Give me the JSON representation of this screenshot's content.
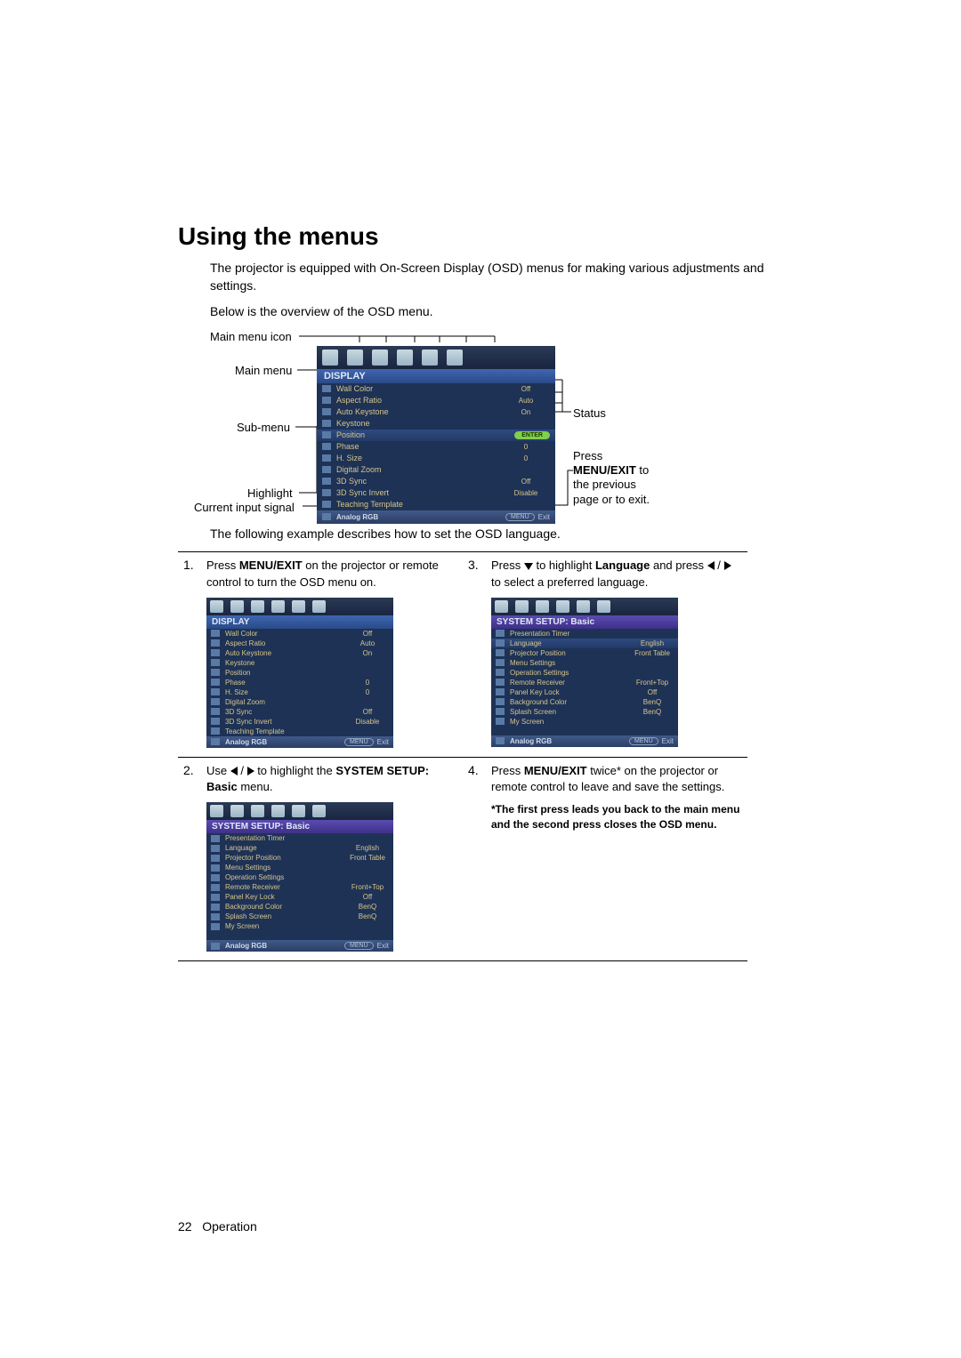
{
  "heading": "Using the menus",
  "intro1": "The projector is equipped with On-Screen Display (OSD) menus for making various adjustments and settings.",
  "intro2": "Below is the overview of the OSD menu.",
  "labels": {
    "main_menu_icon": "Main menu icon",
    "main_menu": "Main menu",
    "sub_menu": "Sub-menu",
    "highlight": "Highlight",
    "current_input": "Current input signal",
    "status": "Status",
    "press_menu_exit": "Press MENU/EXIT to the previous page or to exit."
  },
  "osd_main": {
    "title": "DISPLAY",
    "rows": [
      {
        "label": "Wall Color",
        "value": "Off"
      },
      {
        "label": "Aspect Ratio",
        "value": "Auto"
      },
      {
        "label": "Auto Keystone",
        "value": "On"
      },
      {
        "label": "Keystone",
        "value": ""
      },
      {
        "label": "Position",
        "value": "ENTER",
        "hl": true,
        "enter": true
      },
      {
        "label": "Phase",
        "value": "0"
      },
      {
        "label": "H. Size",
        "value": "0"
      },
      {
        "label": "Digital Zoom",
        "value": ""
      },
      {
        "label": "3D Sync",
        "value": "Off"
      },
      {
        "label": "3D Sync Invert",
        "value": "Disable"
      },
      {
        "label": "Teaching Template",
        "value": ""
      }
    ],
    "footer_signal": "Analog RGB",
    "footer_menu": "MENU",
    "footer_exit": "Exit"
  },
  "example_intro": "The following example describes how to set the OSD language.",
  "steps": {
    "s1": {
      "num": "1.",
      "text_a": "Press ",
      "menu_exit": "MENU/EXIT",
      "text_b": " on the projector or remote control to turn the OSD menu on."
    },
    "s2": {
      "num": "2.",
      "text_a": "Use ",
      "text_b": " to highlight the ",
      "sys": "SYSTEM SETUP: Basic",
      "text_c": " menu."
    },
    "s3": {
      "num": "3.",
      "text_a": "Press ",
      "text_b": " to highlight ",
      "lang": "Language",
      "text_c": " and press ",
      "text_d": " to select a preferred language."
    },
    "s4": {
      "num": "4.",
      "text_a": "Press ",
      "menu_exit": "MENU/EXIT",
      "text_b": " twice* on the projector or remote control to leave and save the settings.",
      "note": "*The first press leads you back to the main menu and the second press closes the OSD menu."
    }
  },
  "osd_sys": {
    "title": "SYSTEM SETUP: Basic",
    "rows": [
      {
        "label": "Presentation Timer",
        "value": ""
      },
      {
        "label": "Language",
        "value": "English"
      },
      {
        "label": "Projector Position",
        "value": "Front Table"
      },
      {
        "label": "Menu Settings",
        "value": ""
      },
      {
        "label": "Operation Settings",
        "value": ""
      },
      {
        "label": "Remote Receiver",
        "value": "Front+Top"
      },
      {
        "label": "Panel Key Lock",
        "value": "Off"
      },
      {
        "label": "Background Color",
        "value": "BenQ"
      },
      {
        "label": "Splash Screen",
        "value": "BenQ"
      },
      {
        "label": "My Screen",
        "value": ""
      }
    ],
    "footer_signal": "Analog RGB",
    "footer_menu": "MENU",
    "footer_exit": "Exit"
  },
  "osd_sys3": {
    "title": "SYSTEM SETUP: Basic",
    "rows": [
      {
        "label": "Presentation Timer",
        "value": ""
      },
      {
        "label": "Language",
        "value": "English",
        "hl": true
      },
      {
        "label": "Projector Position",
        "value": "Front Table"
      },
      {
        "label": "Menu Settings",
        "value": ""
      },
      {
        "label": "Operation Settings",
        "value": ""
      },
      {
        "label": "Remote Receiver",
        "value": "Front+Top"
      },
      {
        "label": "Panel Key Lock",
        "value": "Off"
      },
      {
        "label": "Background Color",
        "value": "BenQ"
      },
      {
        "label": "Splash Screen",
        "value": "BenQ"
      },
      {
        "label": "My Screen",
        "value": ""
      }
    ],
    "footer_signal": "Analog RGB",
    "footer_menu": "MENU",
    "footer_exit": "Exit"
  },
  "page_footer": {
    "num": "22",
    "section": "Operation"
  }
}
